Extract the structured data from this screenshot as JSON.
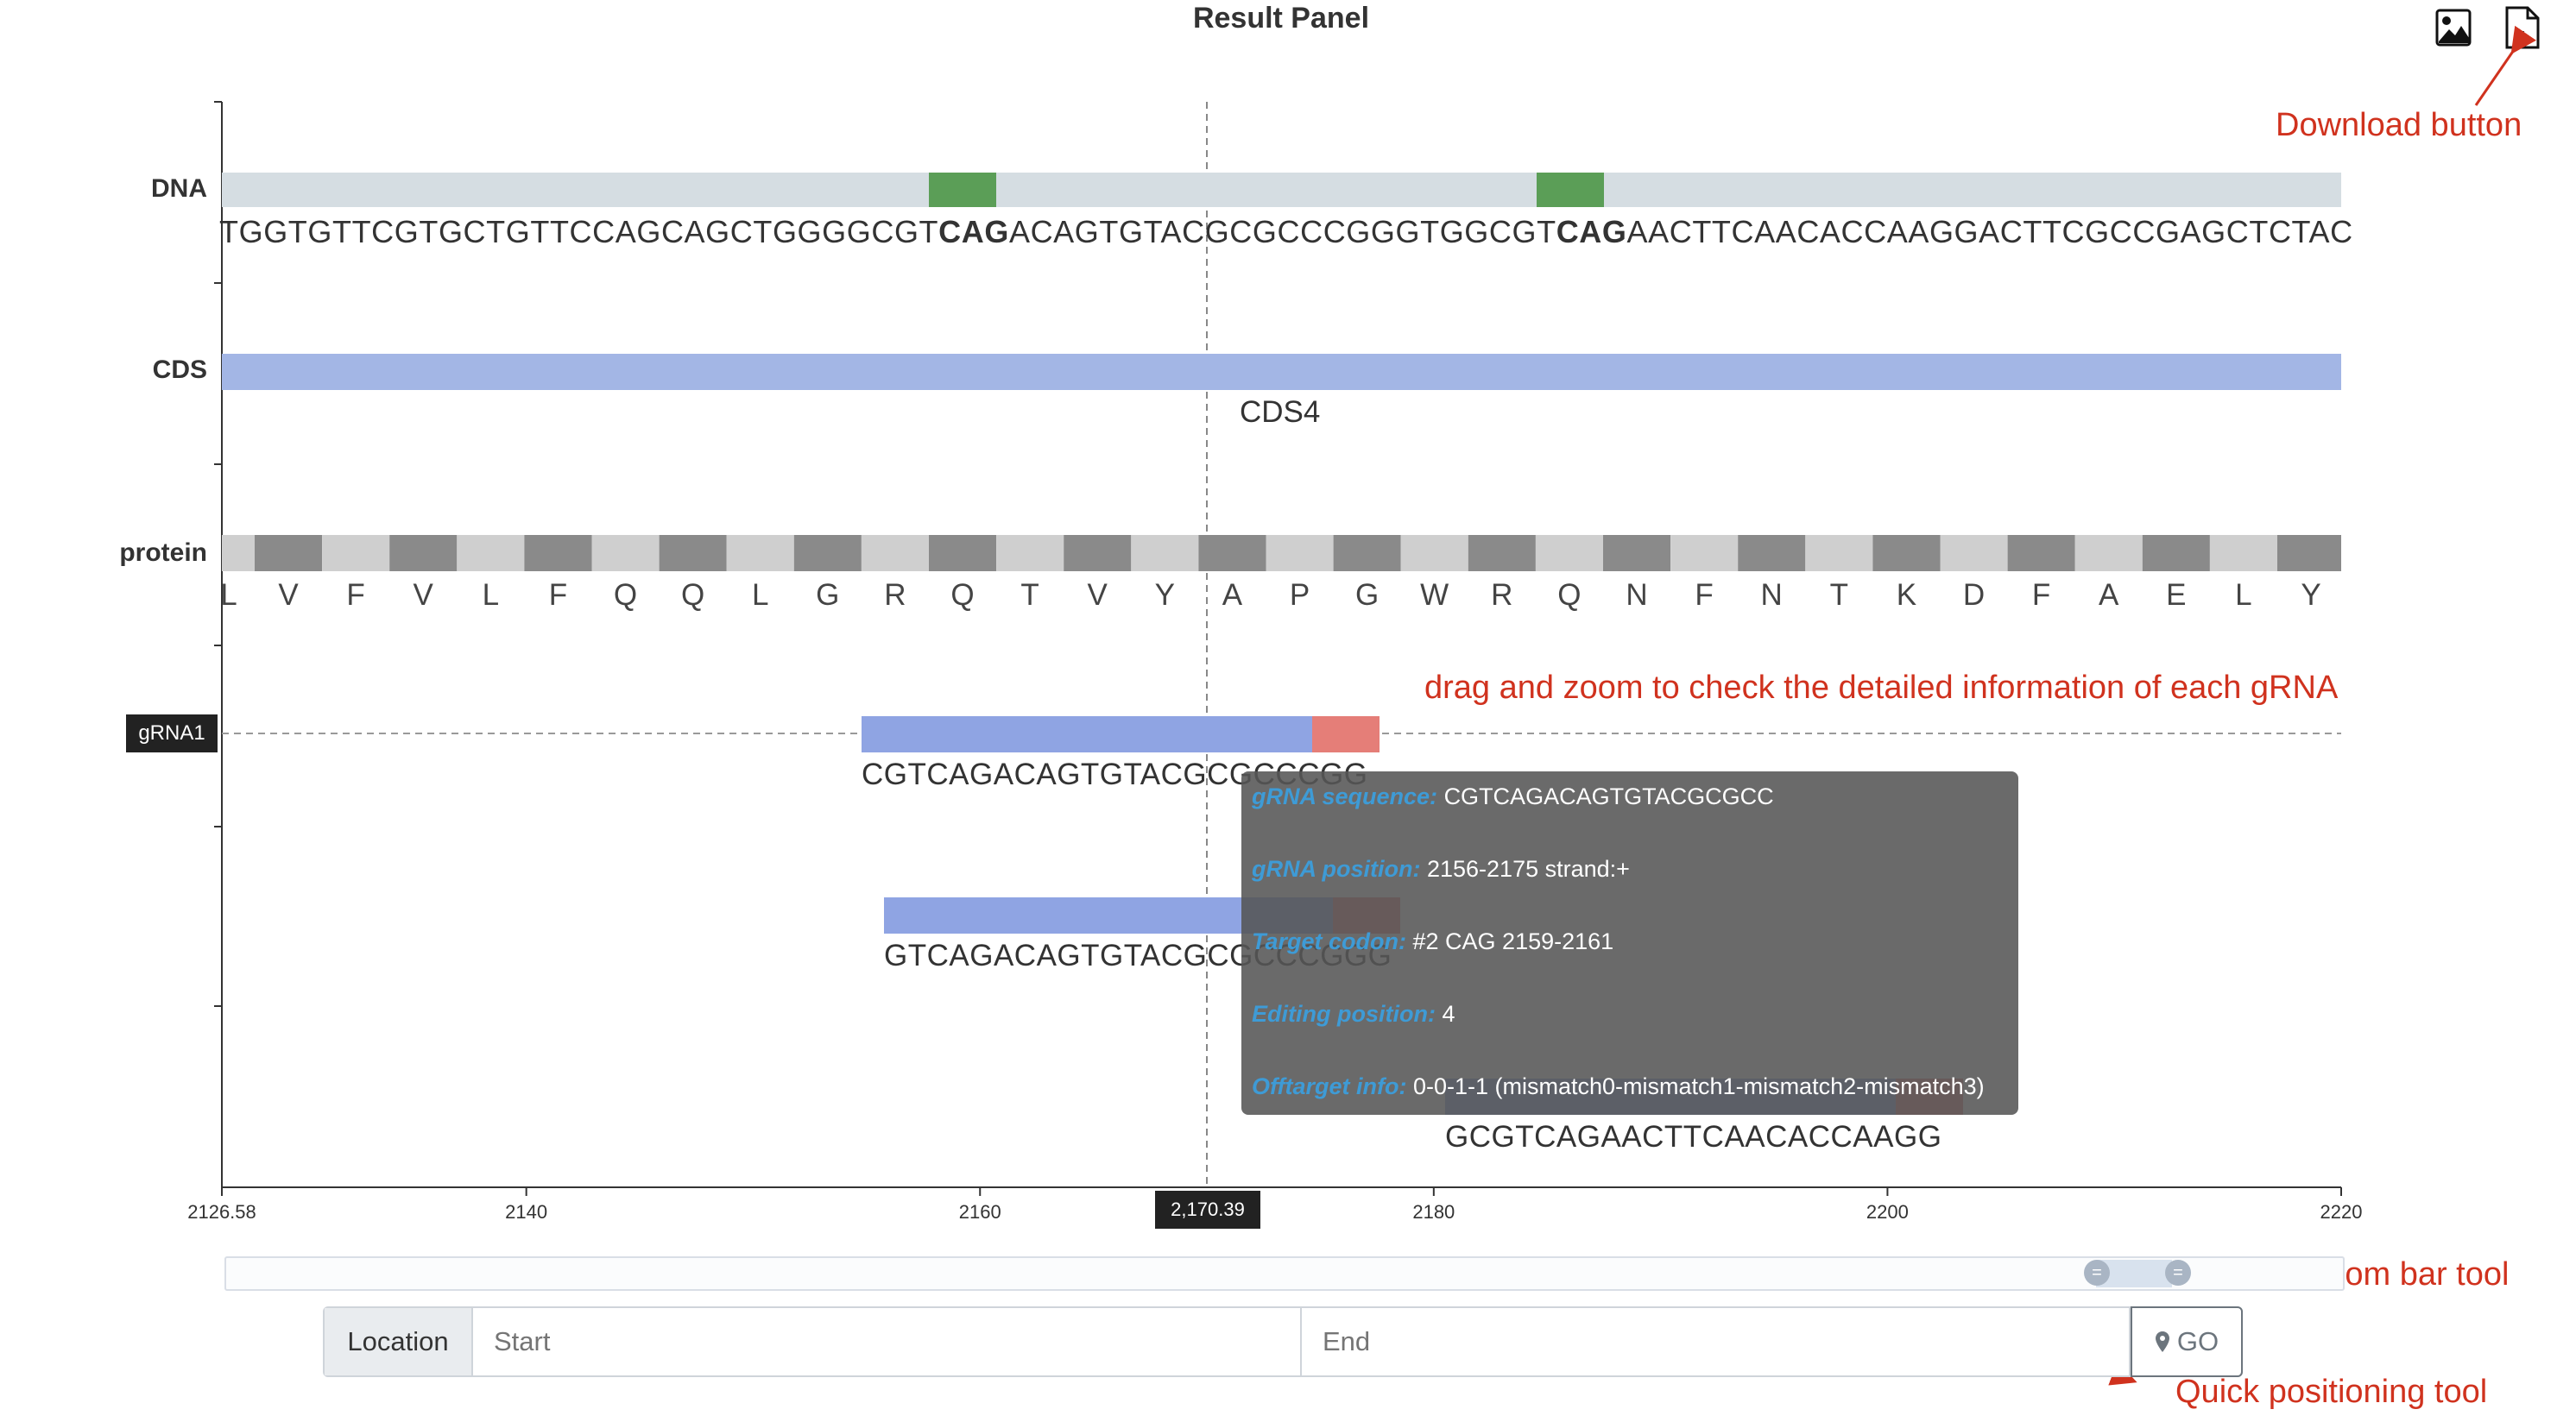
{
  "title": "Result Panel",
  "toolbar": {
    "download_image_icon": "image-download-icon",
    "download_excel_icon": "excel-download-icon"
  },
  "annotations": {
    "download": "Download button",
    "drag_zoom": "drag and zoom to check the detailed information of each gRNA",
    "zoom_bar": "Zoom bar tool",
    "quick_positioning": "Quick positioning tool"
  },
  "tracks": {
    "dna_label": "DNA",
    "cds_label": "CDS",
    "protein_label": "protein",
    "grna1_label": "gRNA1"
  },
  "dna": {
    "seq_part1": "TGGTGTTCGTGCTGTTCCAGCAGCTGGGGCGT",
    "codon1": "CAG",
    "seq_part2": "ACAGTGTACGCGCCCGGGTGGCGT",
    "codon2": "CAG",
    "seq_part3": "AACTTCAACACCAAGGACTTCGCCGAGCTCTAC"
  },
  "cds": {
    "name": "CDS4"
  },
  "protein": {
    "amino_acids": [
      "L",
      "V",
      "F",
      "V",
      "L",
      "F",
      "Q",
      "Q",
      "L",
      "G",
      "R",
      "Q",
      "T",
      "V",
      "Y",
      "A",
      "P",
      "G",
      "W",
      "R",
      "Q",
      "N",
      "F",
      "N",
      "T",
      "K",
      "D",
      "F",
      "A",
      "E",
      "L",
      "Y"
    ]
  },
  "grnas": [
    {
      "sequence": "CGTCAGACAGTGTACGCGCCCGG"
    },
    {
      "sequence": "GTCAGACAGTGTACGCGCCCGGG"
    },
    {
      "sequence": "GCGTCAGAACTTCAACACCAAGG"
    }
  ],
  "tooltip": {
    "seq_key": "gRNA sequence:",
    "seq_val": "CGTCAGACAGTGTACGCGCC",
    "pos_key": "gRNA position:",
    "pos_val": "2156-2175 strand:+",
    "codon_key": "Target codon:",
    "codon_val": "#2 CAG 2159-2161",
    "edit_key": "Editing position:",
    "edit_val": "4",
    "off_key": "Offtarget info:",
    "off_val": "0-0-1-1 (mismatch0-mismatch1-mismatch2-mismatch3)"
  },
  "axis": {
    "cursor_value": "2,170.39",
    "ticks": [
      {
        "label": "2126.58",
        "value": 2126.58
      },
      {
        "label": "2140",
        "value": 2140
      },
      {
        "label": "2160",
        "value": 2160
      },
      {
        "label": "2180",
        "value": 2180
      },
      {
        "label": "2200",
        "value": 2200
      },
      {
        "label": "2220",
        "value": 2220
      }
    ]
  },
  "location": {
    "addon_label": "Location",
    "start_placeholder": "Start",
    "end_placeholder": "End",
    "go_label": "GO"
  },
  "colors": {
    "dna_track": "#d5dde2",
    "codon_highlight": "#5b9e57",
    "cds_track": "#a3b6e5",
    "protein_dark": "#8a8a8a",
    "protein_light": "#cfcfcf",
    "grna_body": "#8fa4e3",
    "grna_pam": "#e57e78",
    "annotation": "#d0321e"
  }
}
